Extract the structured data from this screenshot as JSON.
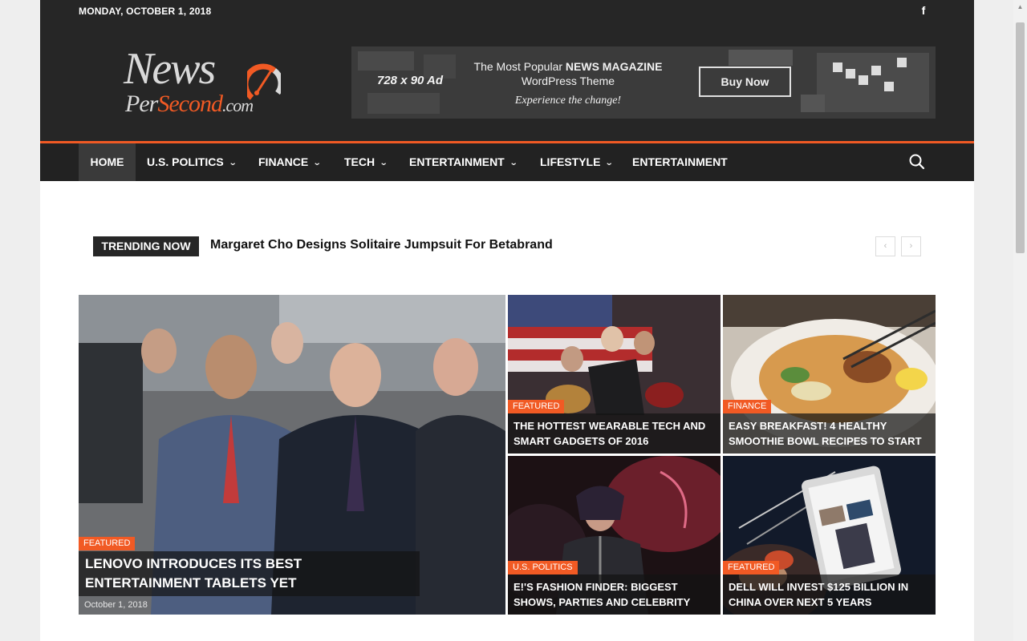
{
  "header": {
    "date": "MONDAY, OCTOBER 1, 2018",
    "social_icon": "facebook-icon",
    "logo": {
      "news": "News",
      "per": "Per",
      "second": "Second",
      "com": ".com"
    },
    "banner": {
      "size_label": "728 x 90 Ad",
      "line1_prefix": "The Most Popular ",
      "line1_bold": "NEWS MAGAZINE",
      "line2": "WordPress Theme",
      "line3": "Experience the change!",
      "button_label": "Buy Now"
    }
  },
  "nav": {
    "items": [
      {
        "label": "HOME",
        "active": true,
        "dropdown": false
      },
      {
        "label": "U.S. POLITICS",
        "dropdown": true
      },
      {
        "label": "FINANCE",
        "dropdown": true
      },
      {
        "label": "TECH",
        "dropdown": true
      },
      {
        "label": "ENTERTAINMENT",
        "dropdown": true
      },
      {
        "label": "LIFESTYLE",
        "dropdown": true
      },
      {
        "label": "ENTERTAINMENT",
        "dropdown": false
      }
    ],
    "search_icon": "search-icon"
  },
  "trending": {
    "label": "TRENDING NOW",
    "title": "Margaret Cho Designs Solitaire Jumpsuit For Betabrand",
    "prev": "‹",
    "next": "›"
  },
  "featured": {
    "main": {
      "category": "FEATURED",
      "title": "LENOVO INTRODUCES ITS BEST ENTERTAINMENT TABLETS YET",
      "date": "October 1, 2018"
    },
    "tiles": [
      {
        "category": "FEATURED",
        "title": "THE HOTTEST WEARABLE TECH AND SMART GADGETS OF 2016"
      },
      {
        "category": "FINANCE",
        "title": "EASY BREAKFAST! 4 HEALTHY SMOOTHIE BOWL RECIPES TO START"
      },
      {
        "category": "U.S. POLITICS",
        "title": "E!'S FASHION FINDER: BIGGEST SHOWS, PARTIES AND CELEBRITY"
      },
      {
        "category": "FEATURED",
        "title": "DELL WILL INVEST $125 BILLION IN CHINA OVER NEXT 5 YEARS"
      }
    ]
  },
  "colors": {
    "accent": "#f15a24",
    "header_bg": "#262626",
    "nav_bg": "#222222"
  }
}
